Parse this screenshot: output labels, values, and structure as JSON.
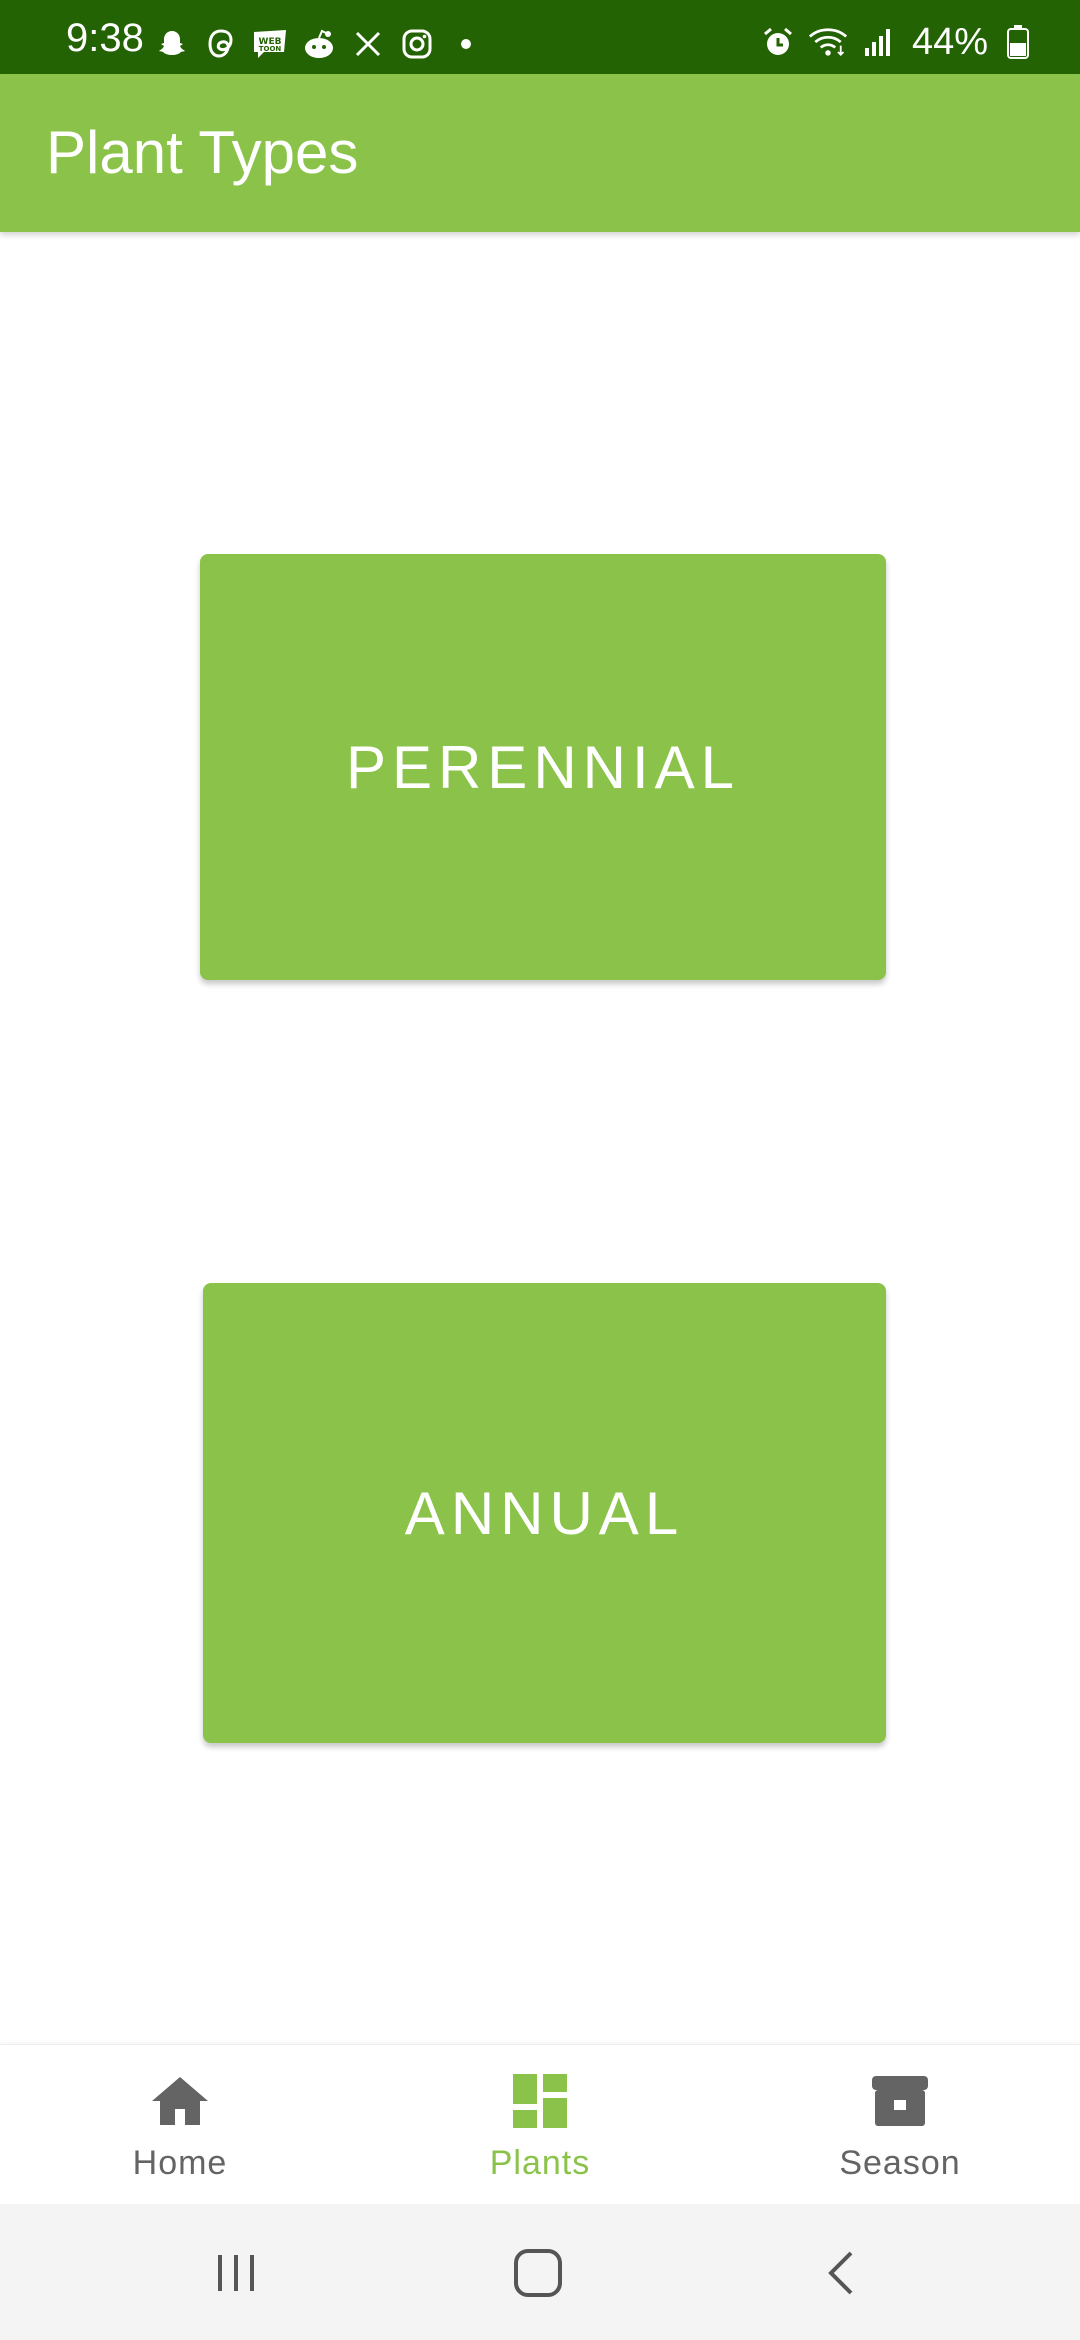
{
  "status_bar": {
    "time": "9:38",
    "battery": "44%",
    "left_icons": [
      "snapchat-icon",
      "threads-icon",
      "webtoon-icon",
      "reddit-icon",
      "x-icon",
      "instagram-icon",
      "dot-icon"
    ],
    "right_icons": [
      "alarm-icon",
      "wifi-icon",
      "signal-icon",
      "battery-icon"
    ],
    "background": "#246303"
  },
  "app_bar": {
    "title": "Plant Types",
    "color": "#8bc34a"
  },
  "buttons": {
    "perennial": "PERENNIAL",
    "annual": "ANNUAL"
  },
  "bottom_nav": {
    "items": [
      {
        "label": "Home",
        "icon": "home-icon",
        "active": false
      },
      {
        "label": "Plants",
        "icon": "dashboard-icon",
        "active": true
      },
      {
        "label": "Season",
        "icon": "archive-icon",
        "active": false
      }
    ],
    "active_color": "#8bc34a",
    "inactive_color": "#646464"
  },
  "system_nav": {
    "buttons": [
      "recents-icon",
      "home-outline-icon",
      "back-icon"
    ]
  }
}
